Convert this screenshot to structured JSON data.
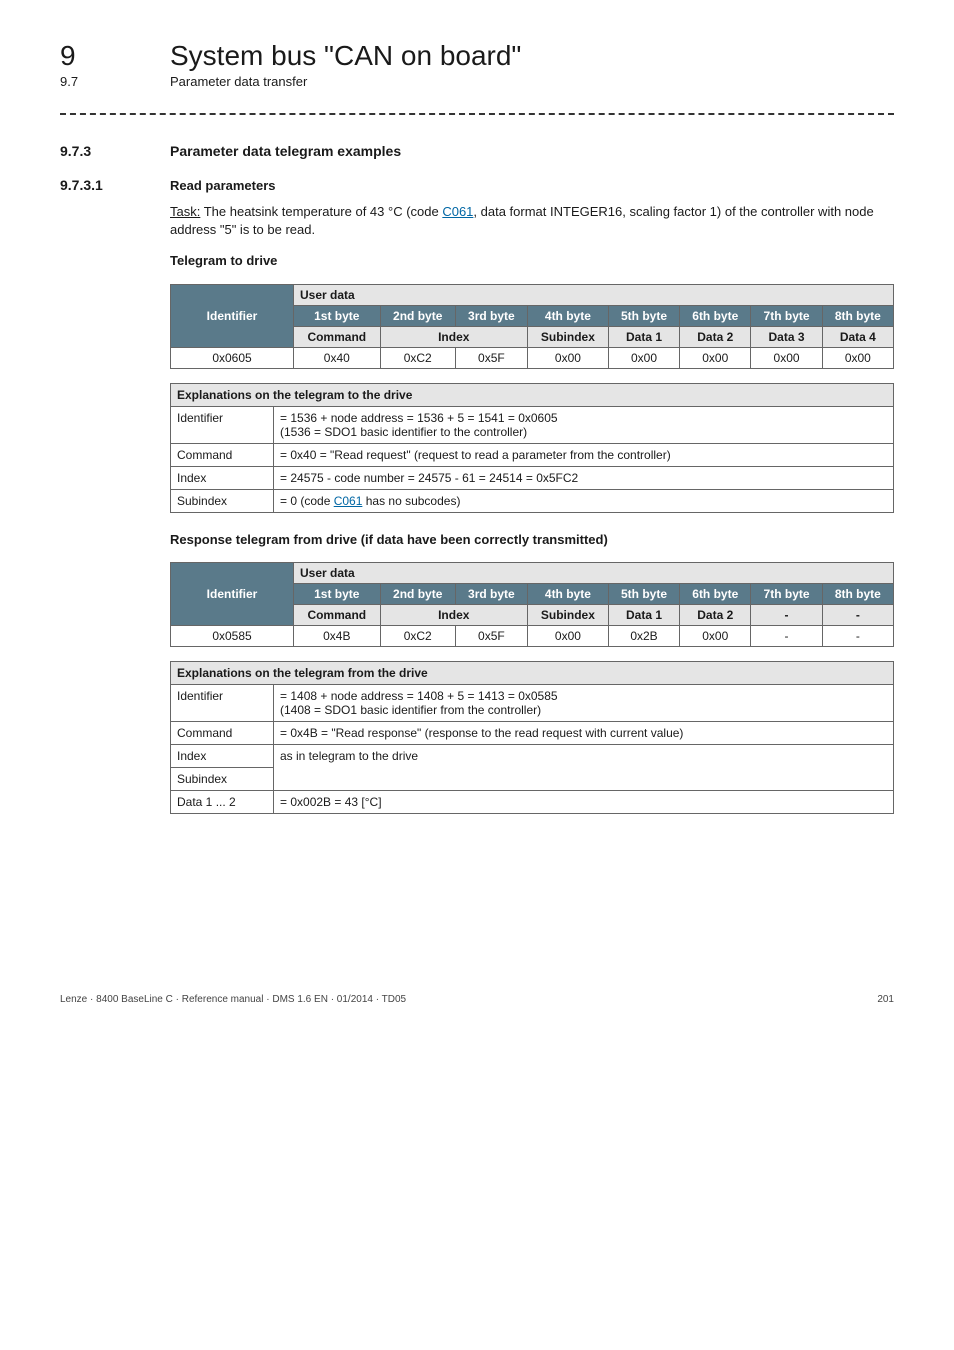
{
  "header": {
    "chapter_num": "9",
    "chapter_title": "System bus \"CAN on board\"",
    "section_num": "9.7",
    "section_title": "Parameter data transfer"
  },
  "h3": {
    "num": "9.7.3",
    "title": "Parameter data telegram examples"
  },
  "h4": {
    "num": "9.7.3.1",
    "title": "Read parameters"
  },
  "task": {
    "label": "Task:",
    "pre": " The heatsink temperature of 43 °C (code ",
    "code": "C061",
    "post": ", data format INTEGER16, scaling factor 1) of the controller with node address \"5\" is to be read."
  },
  "sec1_title": "Telegram to drive",
  "tg_headers": {
    "identifier": "Identifier",
    "userdata": "User data",
    "bytes": [
      "1st byte",
      "2nd byte",
      "3rd byte",
      "4th byte",
      "5th byte",
      "6th byte",
      "7th byte",
      "8th byte"
    ],
    "row3": [
      "Command",
      "Index",
      "Subindex",
      "Data 1",
      "Data 2",
      "Data 3",
      "Data 4"
    ]
  },
  "tg1_vals": [
    "0x0605",
    "0x40",
    "0xC2",
    "0x5F",
    "0x00",
    "0x00",
    "0x00",
    "0x00",
    "0x00"
  ],
  "expl1_title": "Explanations on the telegram to the drive",
  "expl1_rows": [
    {
      "k": "Identifier",
      "v": "= 1536 + node address = 1536 + 5 = 1541 = 0x0605\n(1536 = SDO1 basic identifier to the controller)"
    },
    {
      "k": "Command",
      "v": "= 0x40 = \"Read request\" (request to read a parameter from the controller)"
    },
    {
      "k": "Index",
      "v": "= 24575 - code number = 24575 - 61 = 24514 = 0x5FC2"
    },
    {
      "k": "Subindex",
      "v_pre": "= 0 (code ",
      "v_code": "C061",
      "v_post": " has no subcodes)"
    }
  ],
  "sec2_title": "Response telegram from drive (if data have been correctly transmitted)",
  "tg2_row3": [
    "Command",
    "Index",
    "Subindex",
    "Data 1",
    "Data 2",
    "-",
    "-"
  ],
  "tg2_vals": [
    "0x0585",
    "0x4B",
    "0xC2",
    "0x5F",
    "0x00",
    "0x2B",
    "0x00",
    "-",
    "-"
  ],
  "expl2_title": "Explanations on the telegram from the drive",
  "expl2_rows": [
    {
      "k": "Identifier",
      "v": "= 1408 + node address = 1408 + 5 = 1413 = 0x0585\n(1408 = SDO1 basic identifier from the controller)"
    },
    {
      "k": "Command",
      "v": "= 0x4B = \"Read response\" (response to the read request with current value)"
    },
    {
      "k": "Index",
      "v": "as in telegram to the drive"
    },
    {
      "k": "Subindex",
      "v": ""
    },
    {
      "k": "Data 1 ... 2",
      "v": "= 0x002B = 43 [°C]"
    }
  ],
  "footer": {
    "left": "Lenze · 8400 BaseLine C · Reference manual · DMS 1.6 EN · 01/2014 · TD05",
    "right": "201"
  }
}
